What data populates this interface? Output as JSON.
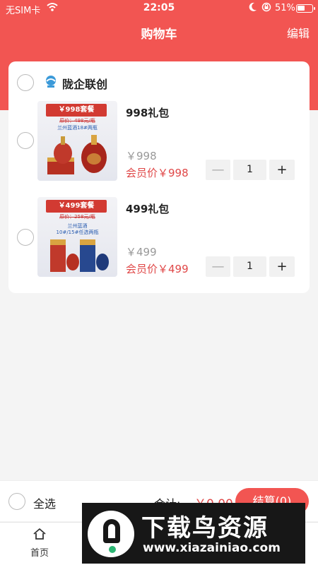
{
  "status_bar": {
    "carrier": "无SIM卡",
    "time": "22:05",
    "battery": "51%",
    "battery_level": 0.51
  },
  "header": {
    "title": "购物车",
    "edit_label": "编辑"
  },
  "store": {
    "name": "陇企联创",
    "items": [
      {
        "name": "998礼包",
        "price": "￥998",
        "member_price": "会员价￥998",
        "quantity": "1",
        "image": {
          "banner": "￥998套餐",
          "original_price": "原价：498元/瓶",
          "desc": "兰州蓝酒18#两瓶"
        }
      },
      {
        "name": "499礼包",
        "price": "￥499",
        "member_price": "会员价￥499",
        "quantity": "1",
        "image": {
          "banner": "￥499套餐",
          "original_price": "原价：258元/瓶",
          "desc": "兰州蓝酒",
          "desc2": "10#/15#任选两瓶"
        }
      }
    ]
  },
  "stepper": {
    "minus": "—",
    "plus": "+"
  },
  "footer": {
    "select_all": "全选",
    "total_label": "合计:",
    "total_value": "￥0.00",
    "checkout_label": "结算(0)"
  },
  "tabbar": {
    "home_label": "首页"
  },
  "watermark": {
    "brand": "下载鸟资源",
    "url": "www.xiazainiao.com"
  },
  "colors": {
    "accent": "#f25552",
    "member_price": "#e04848"
  }
}
